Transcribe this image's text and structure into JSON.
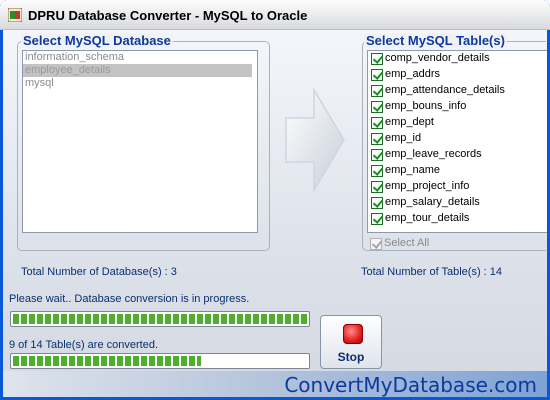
{
  "window": {
    "title": "DPRU Database Converter - MySQL to Oracle"
  },
  "databases": {
    "group_title": "Select MySQL Database",
    "items": [
      {
        "label": "information_schema",
        "selected": false
      },
      {
        "label": "employee_details",
        "selected": true
      },
      {
        "label": "mysql",
        "selected": false
      }
    ],
    "total_label": "Total Number of Database(s) : 3"
  },
  "tables": {
    "group_title": "Select MySQL Table(s)",
    "items": [
      {
        "label": "comp_vendor_details",
        "checked": true
      },
      {
        "label": "emp_addrs",
        "checked": true
      },
      {
        "label": "emp_attendance_details",
        "checked": true
      },
      {
        "label": "emp_bouns_info",
        "checked": true
      },
      {
        "label": "emp_dept",
        "checked": true
      },
      {
        "label": "emp_id",
        "checked": true
      },
      {
        "label": "emp_leave_records",
        "checked": true
      },
      {
        "label": "emp_name",
        "checked": true
      },
      {
        "label": "emp_project_info",
        "checked": true
      },
      {
        "label": "emp_salary_details",
        "checked": true
      },
      {
        "label": "emp_tour_details",
        "checked": true
      }
    ],
    "select_all_label": "Select All",
    "select_all_checked": true,
    "total_label": "Total Number of Table(s) : 14"
  },
  "status": {
    "message": "Please wait.. Database conversion is in progress.",
    "overall_progress_percent": 100,
    "tables_converted_text": "9 of 14 Table(s) are converted.",
    "table_progress_percent": 64
  },
  "controls": {
    "stop_label": "Stop"
  },
  "branding": {
    "text": "ConvertMyDatabase.com"
  },
  "colors": {
    "progress_green": "#4fae2e",
    "title_blue": "#0d3a9c",
    "stop_red": "#e42020"
  },
  "icons": [
    "app-icon",
    "right-arrow-icon",
    "stop-icon"
  ]
}
